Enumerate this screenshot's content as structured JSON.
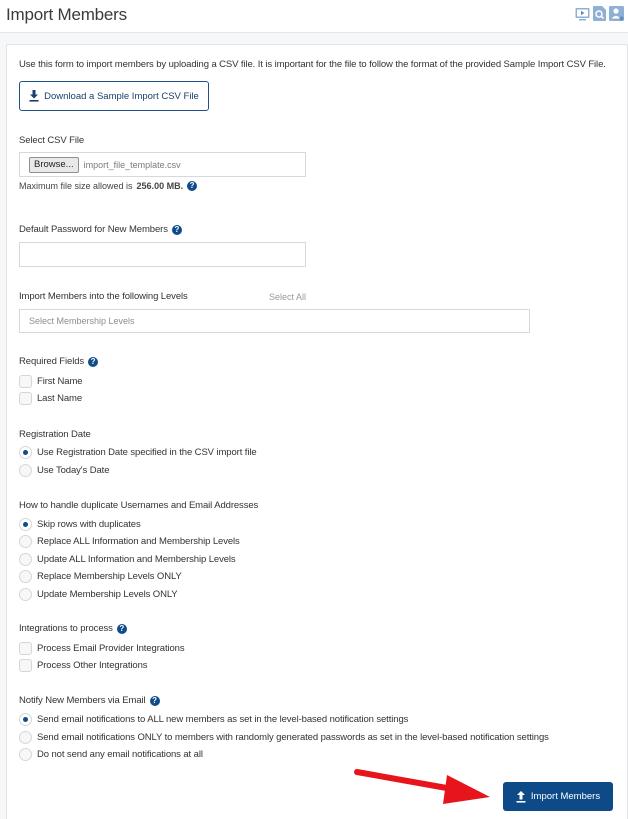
{
  "header": {
    "title": "Import Members",
    "icons": [
      "video-tutorial-icon",
      "search-help-icon",
      "user-account-icon"
    ]
  },
  "intro_text": "Use this form to import members by uploading a CSV file. It is important for the file to follow the format of the provided Sample Import CSV File.",
  "download_button": {
    "label": "Download a Sample Import CSV File",
    "icon": "download-icon"
  },
  "csv_file": {
    "label": "Select CSV File",
    "browse_label": "Browse...",
    "file_name": "import_file_template.csv",
    "hint_prefix": "Maximum file size allowed is",
    "hint_value": "256.00 MB."
  },
  "default_password": {
    "label": "Default Password for New Members",
    "value": "",
    "placeholder": ""
  },
  "levels": {
    "label": "Import Members into the following Levels",
    "select_all": "Select All",
    "placeholder": "Select Membership Levels"
  },
  "required_fields": {
    "label": "Required Fields",
    "options": [
      {
        "label": "First Name",
        "checked": false
      },
      {
        "label": "Last Name",
        "checked": false
      }
    ]
  },
  "registration_date": {
    "label": "Registration Date",
    "options": [
      {
        "label": "Use Registration Date specified in the CSV import file",
        "checked": true
      },
      {
        "label": "Use Today's Date",
        "checked": false
      }
    ]
  },
  "duplicates": {
    "label": "How to handle duplicate Usernames and Email Addresses",
    "options": [
      {
        "label": "Skip rows with duplicates",
        "checked": true
      },
      {
        "label": "Replace ALL Information and Membership Levels",
        "checked": false
      },
      {
        "label": "Update ALL Information and Membership Levels",
        "checked": false
      },
      {
        "label": "Replace Membership Levels ONLY",
        "checked": false
      },
      {
        "label": "Update Membership Levels ONLY",
        "checked": false
      }
    ]
  },
  "integrations": {
    "label": "Integrations to process",
    "options": [
      {
        "label": "Process Email Provider Integrations",
        "checked": false
      },
      {
        "label": "Process Other Integrations",
        "checked": false
      }
    ]
  },
  "notify": {
    "label": "Notify New Members via Email",
    "options": [
      {
        "label": "Send email notifications to ALL new members as set in the level-based notification settings",
        "checked": true
      },
      {
        "label": "Send email notifications ONLY to members with randomly generated passwords as set in the level-based notification settings",
        "checked": false
      },
      {
        "label": "Do not send any email notifications at all",
        "checked": false
      }
    ]
  },
  "import_button": {
    "label": "Import Members",
    "icon": "upload-icon"
  },
  "help_glyph": "?",
  "colors": {
    "primary": "#0e4a88",
    "annotation_arrow": "#e8141b"
  }
}
